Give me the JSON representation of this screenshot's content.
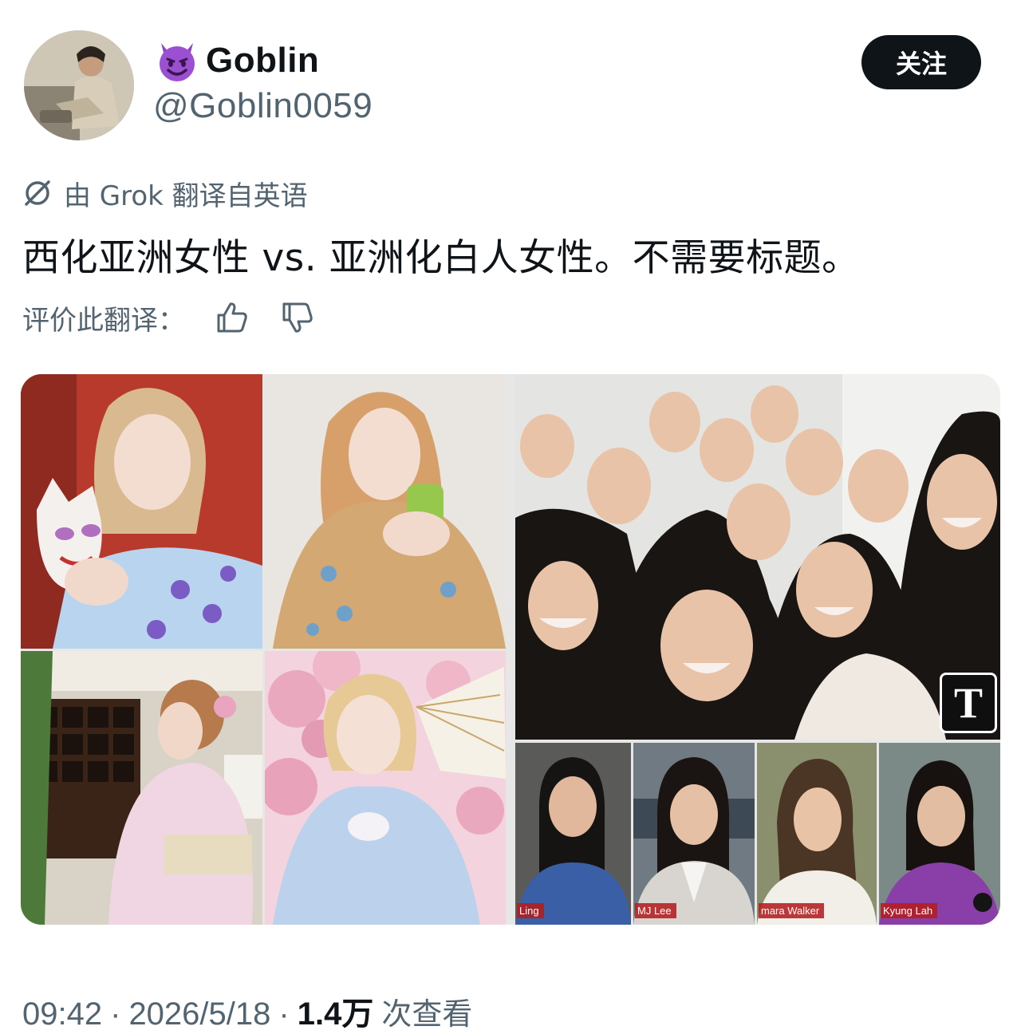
{
  "author": {
    "emoji": "😈",
    "display_name": "Goblin",
    "handle": "@Goblin0059",
    "avatar_icon": "profile-photo-man-seated"
  },
  "follow_button": {
    "label": "关注"
  },
  "translation": {
    "note": "由 Grok 翻译自英语",
    "icon": "grok-icon",
    "rate_label": "评价此翻译：",
    "thumbs_up_icon": "thumbs-up-icon",
    "thumbs_down_icon": "thumbs-down-icon"
  },
  "tweet": {
    "text": "西化亚洲女性 vs. 亚洲化白人女性。不需要标题。"
  },
  "media": {
    "captions": [
      "Ling",
      "MJ Lee",
      "mara Walker",
      "Kyung Lah"
    ],
    "logo_letter": "T"
  },
  "meta": {
    "time": "09:42",
    "separator": "·",
    "date": "2026/5/18",
    "views_count": "1.4万",
    "views_label": "次查看"
  },
  "colors": {
    "text": "#0f1419",
    "secondary": "#536471",
    "button_bg": "#0f1419",
    "button_text": "#ffffff"
  }
}
